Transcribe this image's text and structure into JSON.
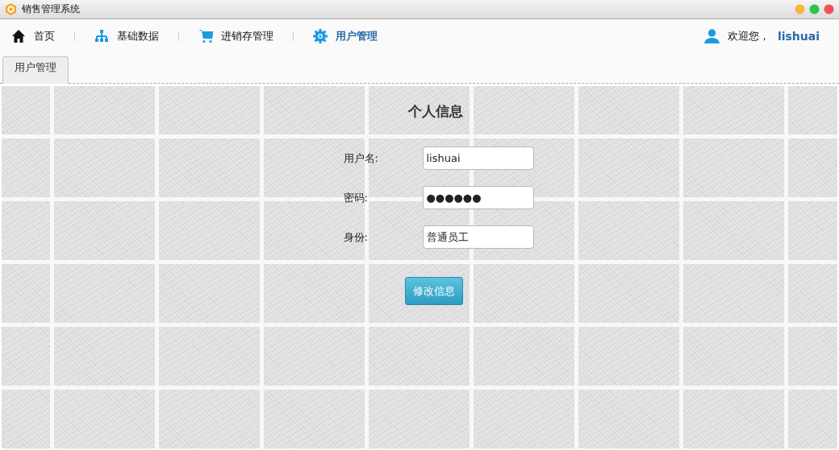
{
  "window": {
    "title": "销售管理系统"
  },
  "nav": {
    "items": [
      {
        "label": "首页",
        "selected": false
      },
      {
        "label": "基础数据",
        "selected": false
      },
      {
        "label": "进销存管理",
        "selected": false
      },
      {
        "label": "用户管理",
        "selected": true
      }
    ],
    "welcome": "欢迎您，",
    "user": "lishuai"
  },
  "tabs": [
    {
      "label": "用户管理",
      "selected": true
    }
  ],
  "form": {
    "title": "个人信息",
    "fields": [
      {
        "label": "用户名:",
        "value": "lishuai"
      },
      {
        "label": "密码:",
        "value": "●●●●●●"
      },
      {
        "label": "身份:",
        "value": "普通员工"
      }
    ],
    "button": "修改信息"
  }
}
